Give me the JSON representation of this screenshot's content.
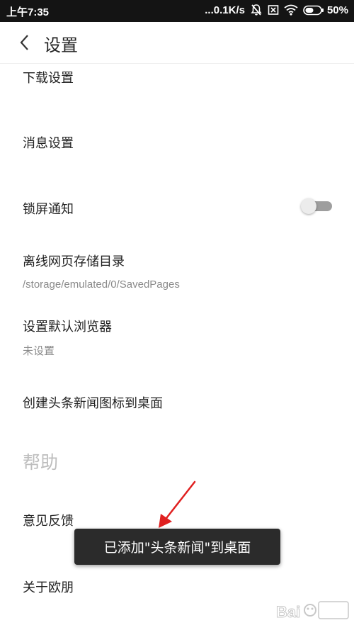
{
  "status_bar": {
    "time": "上午7:35",
    "network_speed": "...0.1K/s",
    "battery_level": "50%",
    "icons": [
      "mute-icon",
      "sim-off-icon",
      "wifi-icon",
      "battery-icon"
    ]
  },
  "header": {
    "title": "设置",
    "back_icon": "chevron-left-icon"
  },
  "settings": {
    "download": "下载设置",
    "messages": "消息设置",
    "lock_screen": {
      "label": "锁屏通知",
      "enabled": false
    },
    "offline_dir": {
      "label": "离线网页存储目录",
      "value": "/storage/emulated/0/SavedPages"
    },
    "default_browser": {
      "label": "设置默认浏览器",
      "value": "未设置"
    },
    "shortcut": "创建头条新闻图标到桌面"
  },
  "help_section": {
    "title": "帮助",
    "feedback": "意见反馈",
    "about": "关于欧朋"
  },
  "toast": {
    "message": "已添加\"头条新闻\"到桌面"
  },
  "colors": {
    "status_bar": "#141414",
    "toast_bg": "#2b2b2b",
    "annotation_arrow": "#e02020",
    "section_header": "#bdbdbd"
  }
}
